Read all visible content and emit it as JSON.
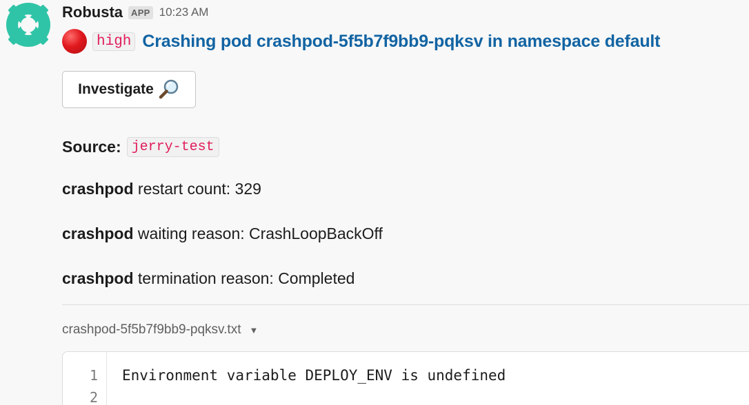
{
  "message": {
    "app_name": "Robusta",
    "app_badge": "APP",
    "timestamp": "10:23 AM",
    "severity": "high",
    "title": "Crashing pod crashpod-5f5b7f9bb9-pqksv in namespace default",
    "investigate_label": "Investigate",
    "source_label": "Source:",
    "source_value": "jerry-test",
    "details": [
      {
        "pod": "crashpod",
        "text": " restart count: 329"
      },
      {
        "pod": "crashpod",
        "text": " waiting reason: CrashLoopBackOff"
      },
      {
        "pod": "crashpod",
        "text": " termination reason: Completed"
      }
    ]
  },
  "attachment": {
    "filename": "crashpod-5f5b7f9bb9-pqksv.txt",
    "lines": [
      {
        "number": "1",
        "text": "Environment variable DEPLOY_ENV is undefined"
      },
      {
        "number": "2",
        "text": ""
      }
    ]
  },
  "colors": {
    "link": "#1264a3",
    "code_pink": "#e01e5a",
    "avatar_teal": "#2fc4a7",
    "severity_red": "#e0191e"
  },
  "icons": {
    "avatar": "robusta-logo-icon",
    "severity": "red-circle-icon",
    "investigate": "magnifying-glass-icon",
    "file_menu": "caret-down-icon"
  }
}
